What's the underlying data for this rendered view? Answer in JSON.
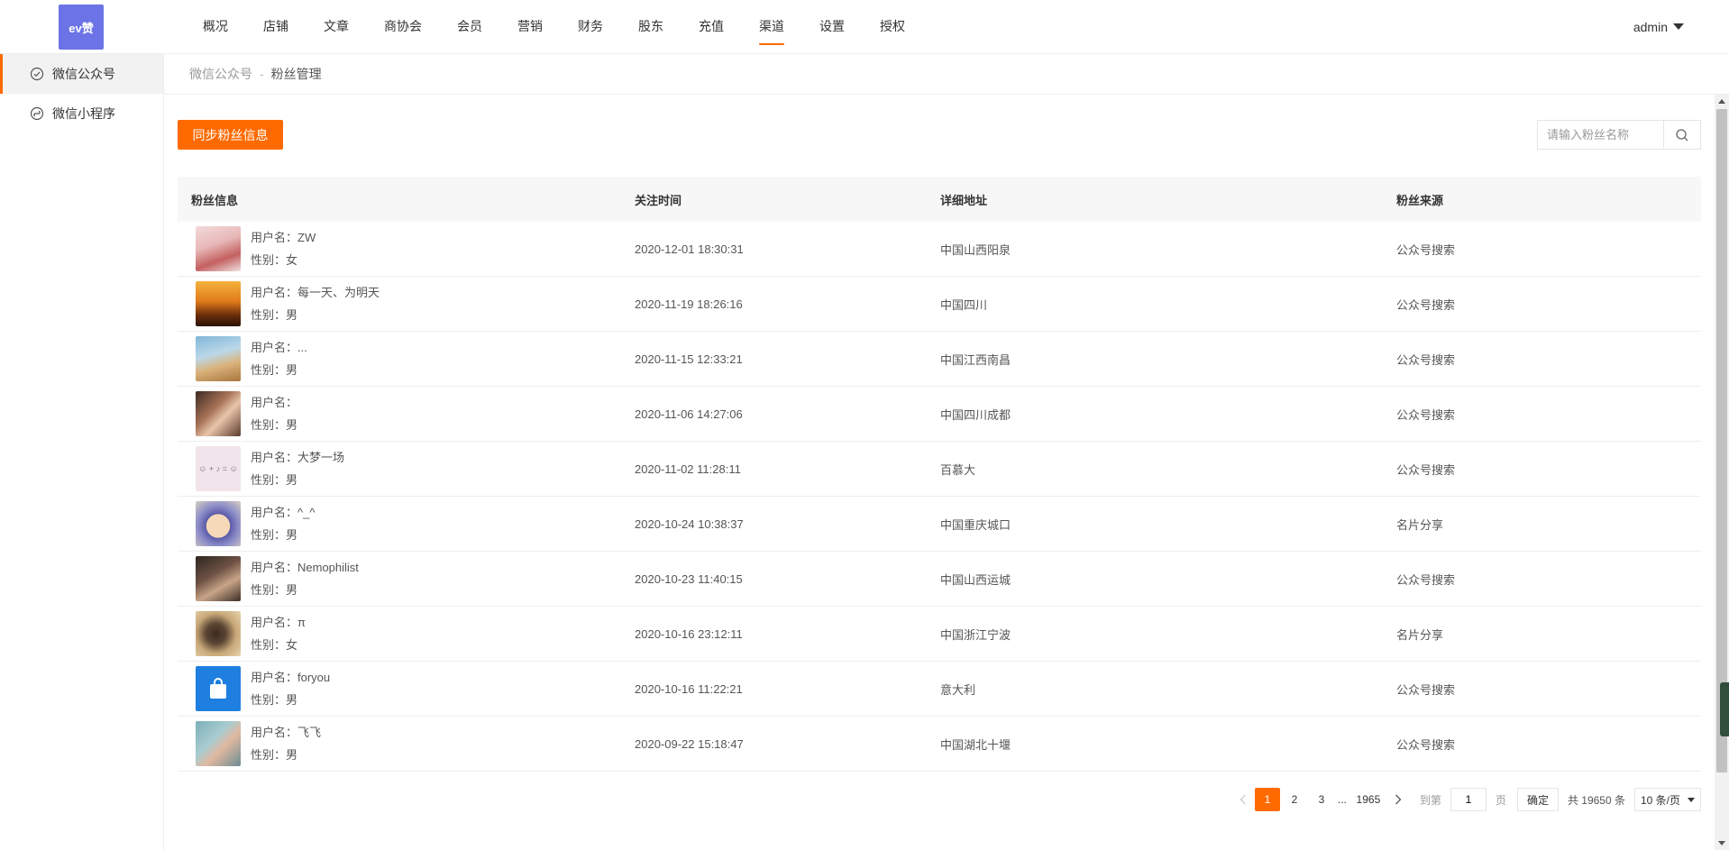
{
  "brand": {
    "logo_text": "ev赞",
    "logo_color": "#6b73e6"
  },
  "nav": {
    "items": [
      "概况",
      "店铺",
      "文章",
      "商协会",
      "会员",
      "营销",
      "财务",
      "股东",
      "充值",
      "渠道",
      "设置",
      "授权"
    ],
    "active": "渠道"
  },
  "user": {
    "name": "admin"
  },
  "sidebar": {
    "items": [
      {
        "label": "微信公众号",
        "icon": "wechat-official-icon",
        "active": true
      },
      {
        "label": "微信小程序",
        "icon": "mini-program-icon",
        "active": false
      }
    ]
  },
  "breadcrumb": {
    "parent": "微信公众号",
    "separator": "-",
    "current": "粉丝管理"
  },
  "toolbar": {
    "sync_label": "同步粉丝信息",
    "search_placeholder": "请输入粉丝名称",
    "search_value": ""
  },
  "table": {
    "headers": [
      "粉丝信息",
      "关注时间",
      "详细地址",
      "粉丝来源"
    ],
    "rows": [
      {
        "name": "用户名：ZW",
        "gender": "性别：女",
        "time": "2020-12-01 18:30:31",
        "address": "中国山西阳泉",
        "source": "公众号搜索"
      },
      {
        "name": "用户名：每一天、为明天",
        "gender": "性别：男",
        "time": "2020-11-19 18:26:16",
        "address": "中国四川",
        "source": "公众号搜索"
      },
      {
        "name": "用户名：...",
        "gender": "性别：男",
        "time": "2020-11-15 12:33:21",
        "address": "中国江西南昌",
        "source": "公众号搜索"
      },
      {
        "name": "用户名：",
        "gender": "性别：男",
        "time": "2020-11-06 14:27:06",
        "address": "中国四川成都",
        "source": "公众号搜索"
      },
      {
        "name": "用户名：大梦一场",
        "gender": "性别：男",
        "time": "2020-11-02 11:28:11",
        "address": "百慕大",
        "source": "公众号搜索"
      },
      {
        "name": "用户名：^_^",
        "gender": "性别：男",
        "time": "2020-10-24 10:38:37",
        "address": "中国重庆城口",
        "source": "名片分享"
      },
      {
        "name": "用户名：Nemophilist",
        "gender": "性别：男",
        "time": "2020-10-23 11:40:15",
        "address": "中国山西运城",
        "source": "公众号搜索"
      },
      {
        "name": "用户名：π",
        "gender": "性别：女",
        "time": "2020-10-16 23:12:11",
        "address": "中国浙江宁波",
        "source": "名片分享"
      },
      {
        "name": "用户名：foryou",
        "gender": "性别：男",
        "time": "2020-10-16 11:22:21",
        "address": "意大利",
        "source": "公众号搜索"
      },
      {
        "name": "用户名：飞飞",
        "gender": "性别：男",
        "time": "2020-09-22 15:18:47",
        "address": "中国湖北十堰",
        "source": "公众号搜索"
      }
    ]
  },
  "pagination": {
    "pages": [
      "1",
      "2",
      "3"
    ],
    "ellipsis": "...",
    "last": "1965",
    "current": "1",
    "goto_label": "到第",
    "goto_value": "1",
    "page_unit": "页",
    "confirm_label": "确定",
    "total": "共 19650 条",
    "page_size": "10 条/页"
  },
  "colors": {
    "accent": "#ff6a00",
    "header_bg": "#f7f7f7"
  }
}
